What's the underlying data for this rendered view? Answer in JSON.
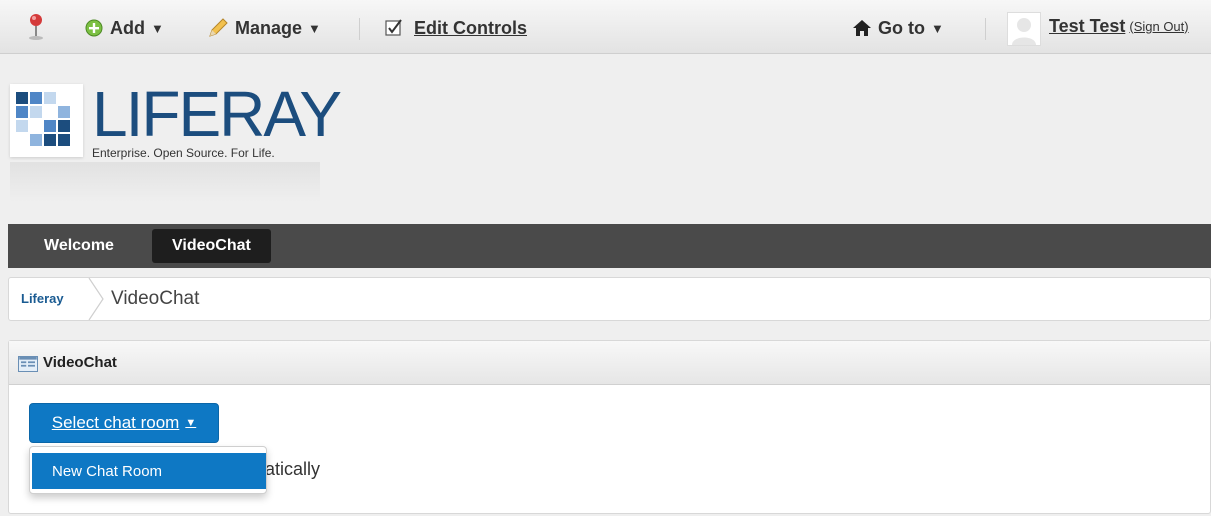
{
  "dockbar": {
    "add_label": "Add",
    "manage_label": "Manage",
    "edit_controls_label": "Edit Controls",
    "goto_label": "Go to",
    "user_name": "Test Test",
    "sign_out_label": "(Sign Out)"
  },
  "logo": {
    "name": "LIFERAY",
    "tagline": "Enterprise. Open Source. For Life."
  },
  "nav": {
    "items": [
      {
        "label": "Welcome"
      },
      {
        "label": "VideoChat"
      }
    ]
  },
  "breadcrumb": {
    "items": [
      {
        "label": "Liferay"
      },
      {
        "label": "VideoChat"
      }
    ]
  },
  "portlet": {
    "title": "VideoChat",
    "select_button_label": "Select chat room",
    "dropdown_items": [
      {
        "label": "New Chat Room"
      }
    ],
    "obscured_text": "atically"
  },
  "colors": {
    "nav_bg": "#4a4a4a",
    "accent": "#0e78c4",
    "brand": "#1c4d7e"
  }
}
